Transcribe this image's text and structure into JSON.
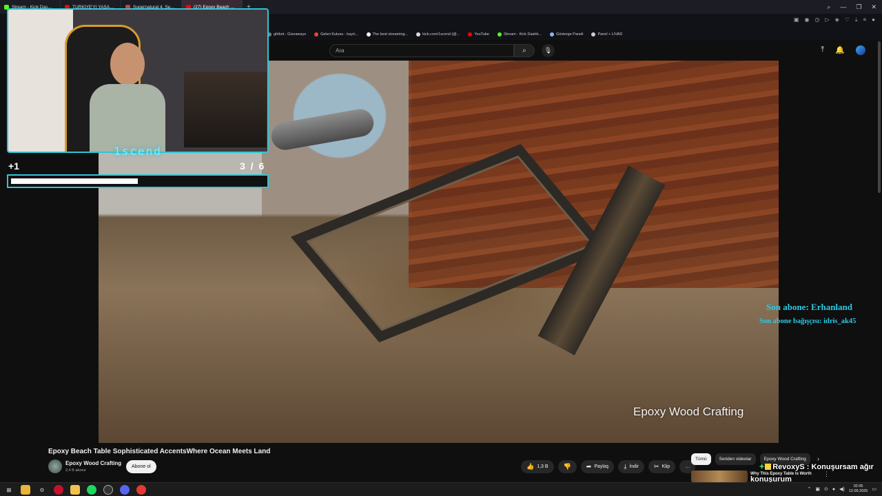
{
  "browser": {
    "tabs": [
      {
        "label": "Stream - Kick Dashboard",
        "color": "#53fc18"
      },
      {
        "label": "TÜRKİYE'Yİ YAŞANAN M...",
        "color": "#ff0000"
      },
      {
        "label": "Supernatural 4. Sezon 7...",
        "color": "#e03a3a"
      },
      {
        "label": "(27) Epoxy Beach Table Sop...",
        "color": "#ff0000",
        "active": true
      }
    ],
    "new_tab": "+",
    "bookmarks": [
      {
        "label": "ghtbot - Giveaways",
        "color": "#7d7d7d"
      },
      {
        "label": "Gelen Kutusu - kayıt...",
        "color": "#ea4335"
      },
      {
        "label": "The best streaming...",
        "color": "#ffffff"
      },
      {
        "label": "kick.com/1scend (@...",
        "color": "#dddddd"
      },
      {
        "label": "YouTube",
        "color": "#ff0000"
      },
      {
        "label": "Stream - Kick Dashb...",
        "color": "#53fc18"
      },
      {
        "label": "Gösterge Paneli",
        "color": "#8fb3ff"
      },
      {
        "label": "Panel + LIVAD",
        "color": "#cccccc"
      }
    ]
  },
  "youtube": {
    "search_placeholder": "Ara"
  },
  "overlay": {
    "streamer_name": "1scend",
    "goal_plus": "+1",
    "goal_count": "3 / 6",
    "goal_progress": 0.5,
    "last_sub": "Son abone: Erhanland",
    "last_donor": "Son abone bağışçısı: idris_ak45"
  },
  "video": {
    "watermark": "Epoxy Wood Crafting",
    "title": "Epoxy Beach Table Sophisticated AccentsWhere Ocean Meets Land",
    "channel_name": "Epoxy Wood Crafting",
    "channel_subs": "2,4 B abone",
    "subscribe_label": "Abone ol",
    "likes": "1,3 B",
    "share_label": "Paylaş",
    "download_label": "İndir",
    "clip_label": "Klip",
    "more_label": "…"
  },
  "recommendations": {
    "chips": [
      "Tümü",
      "Seriden videolar",
      "Epoxy Wood Crafting"
    ],
    "first_title": "Why This Epoxy Table Is Worth"
  },
  "chat_popup": {
    "line1": "RevoxyS : Konuşursam ağır",
    "line2": "konuşurum"
  },
  "taskbar": {
    "time": "02:05",
    "date": "12.09.2025"
  }
}
